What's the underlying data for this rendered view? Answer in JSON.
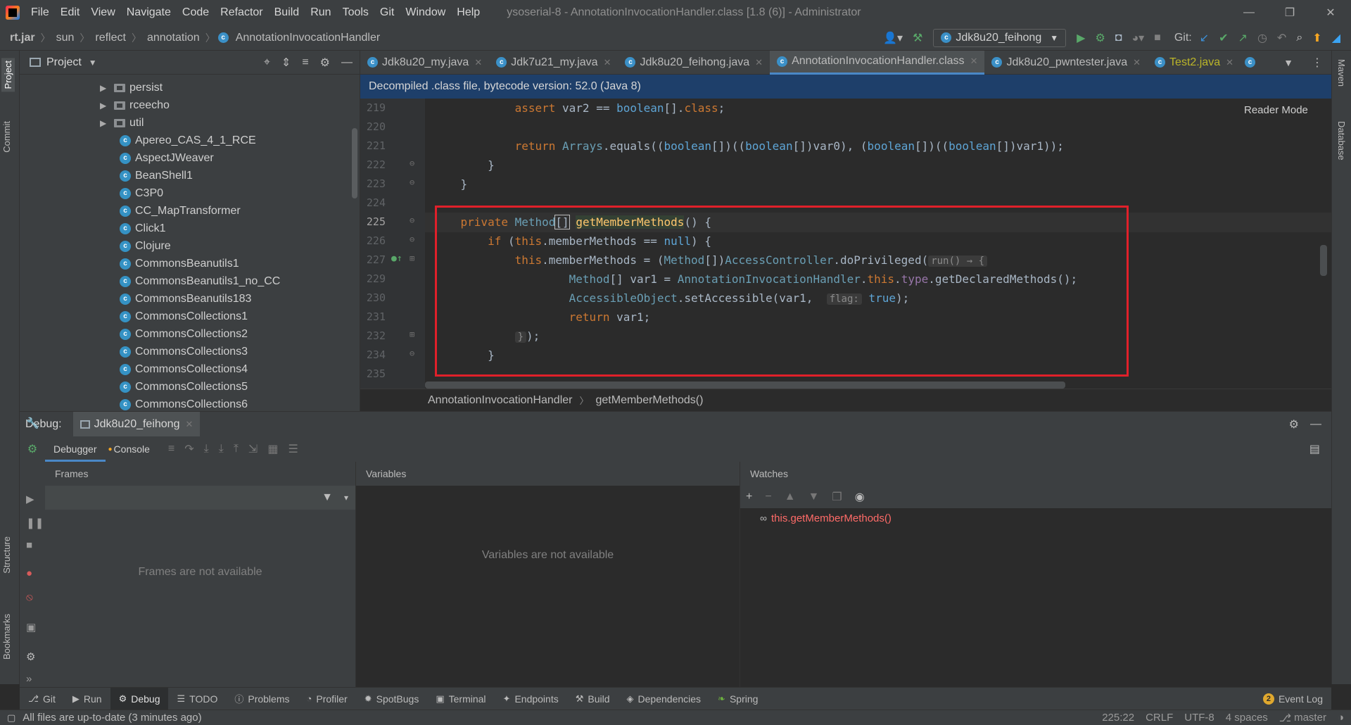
{
  "menubar": {
    "items": [
      "File",
      "Edit",
      "View",
      "Navigate",
      "Code",
      "Refactor",
      "Build",
      "Run",
      "Tools",
      "Git",
      "Window",
      "Help"
    ],
    "window_title": "ysoserial-8 - AnnotationInvocationHandler.class [1.8 (6)] - Administrator"
  },
  "navbar": {
    "crumbs": [
      "rt.jar",
      "sun",
      "reflect",
      "annotation",
      "AnnotationInvocationHandler"
    ],
    "run_config": "Jdk8u20_feihong",
    "git_label": "Git:"
  },
  "left_strip": {
    "project": "Project",
    "commit": "Commit",
    "structure": "Structure",
    "bookmarks": "Bookmarks"
  },
  "right_strip": {
    "maven": "Maven",
    "database": "Database"
  },
  "project_panel": {
    "title": "Project",
    "folders": [
      "persist",
      "rceecho",
      "util"
    ],
    "classes": [
      "Apereo_CAS_4_1_RCE",
      "AspectJWeaver",
      "BeanShell1",
      "C3P0",
      "CC_MapTransformer",
      "Click1",
      "Clojure",
      "CommonsBeanutils1",
      "CommonsBeanutils1_no_CC",
      "CommonsBeanutils183",
      "CommonsCollections1",
      "CommonsCollections2",
      "CommonsCollections3",
      "CommonsCollections4",
      "CommonsCollections5",
      "CommonsCollections6"
    ]
  },
  "editor_tabs": [
    {
      "label": "Jdk8u20_my.java",
      "active": false
    },
    {
      "label": "Jdk7u21_my.java",
      "active": false
    },
    {
      "label": "Jdk8u20_feihong.java",
      "active": false
    },
    {
      "label": "AnnotationInvocationHandler.class",
      "active": true
    },
    {
      "label": "Jdk8u20_pwntester.java",
      "active": false
    },
    {
      "label": "Test2.java",
      "active": false
    }
  ],
  "editor": {
    "banner": "Decompiled .class file, bytecode version: 52.0 (Java 8)",
    "reader_mode": "Reader Mode",
    "line_numbers": [
      "219",
      "220",
      "221",
      "222",
      "223",
      "224",
      "225",
      "226",
      "227",
      "229",
      "230",
      "231",
      "232",
      "234",
      "235"
    ],
    "breadcrumb_class": "AnnotationInvocationHandler",
    "breadcrumb_method": "getMemberMethods()"
  },
  "debug": {
    "label": "Debug:",
    "session": "Jdk8u20_feihong",
    "tabs": [
      "Debugger",
      "Console"
    ],
    "frames_header": "Frames",
    "frames_empty": "Frames are not available",
    "variables_header": "Variables",
    "variables_empty": "Variables are not available",
    "watches_header": "Watches",
    "watch_expression": "this.getMemberMethods()"
  },
  "toolwindows": [
    "Git",
    "Run",
    "Debug",
    "TODO",
    "Problems",
    "Profiler",
    "SpotBugs",
    "Terminal",
    "Endpoints",
    "Build",
    "Dependencies",
    "Spring"
  ],
  "event_log": {
    "count": "2",
    "label": "Event Log"
  },
  "statusbar": {
    "message": "All files are up-to-date (3 minutes ago)",
    "position": "225:22",
    "line_sep": "CRLF",
    "encoding": "UTF-8",
    "indent": "4 spaces",
    "branch": "master"
  },
  "colors": {
    "highlight_box": "#e0202a",
    "banner": "#1e3f6a",
    "accent": "#4a88c7",
    "watch_text": "#ff6b68"
  }
}
